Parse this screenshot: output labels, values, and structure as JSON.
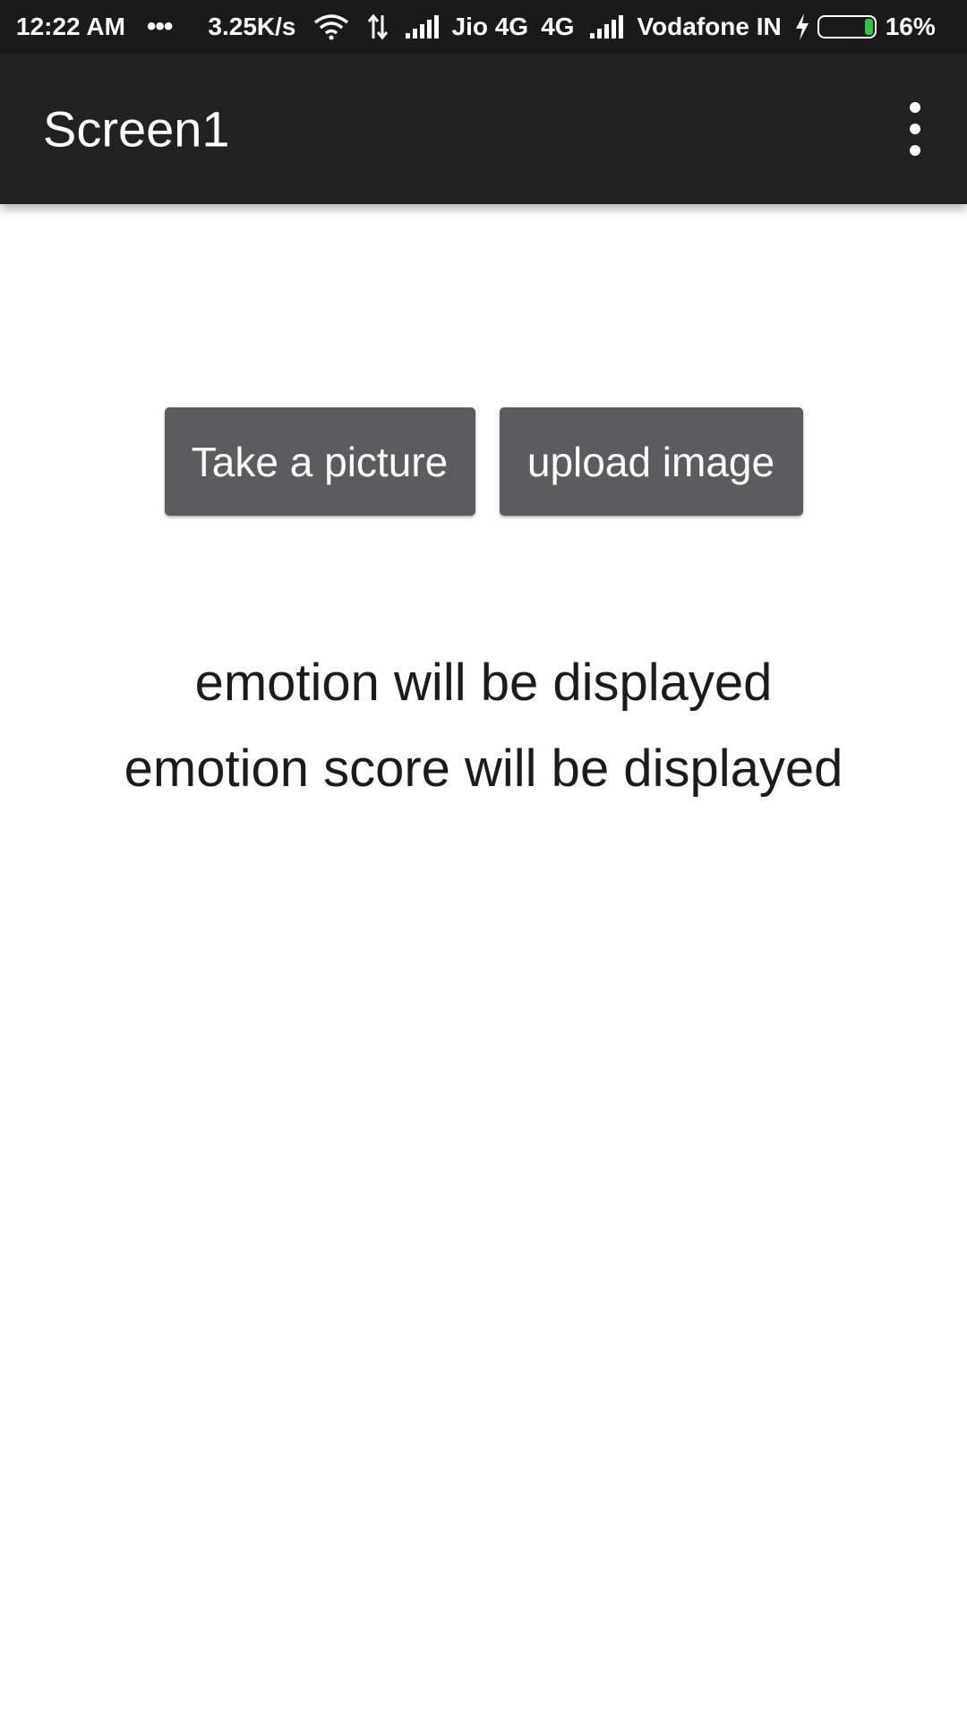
{
  "status_bar": {
    "time": "12:22 AM",
    "more_indicator": "•••",
    "net_speed": "3.25K/s",
    "carrier1": "Jio 4G",
    "network_type": "4G",
    "carrier2": "Vodafone IN",
    "battery_percent": "16%",
    "battery_level": 0.16,
    "icons": [
      "wifi-icon",
      "data-transfer-icon",
      "signal-icon",
      "signal-icon",
      "charging-icon",
      "battery-icon"
    ]
  },
  "app_bar": {
    "title": "Screen1",
    "menu_icon": "more-vert-icon"
  },
  "main": {
    "take_picture_label": "Take a picture",
    "upload_image_label": "upload image",
    "emotion_text": "emotion will be displayed",
    "emotion_score_text": "emotion score will be displayed"
  },
  "colors": {
    "app_bar": "#212121",
    "status_bar": "#1a1a1a",
    "button": "#5c5c5e",
    "battery_fill": "#35c24a"
  }
}
